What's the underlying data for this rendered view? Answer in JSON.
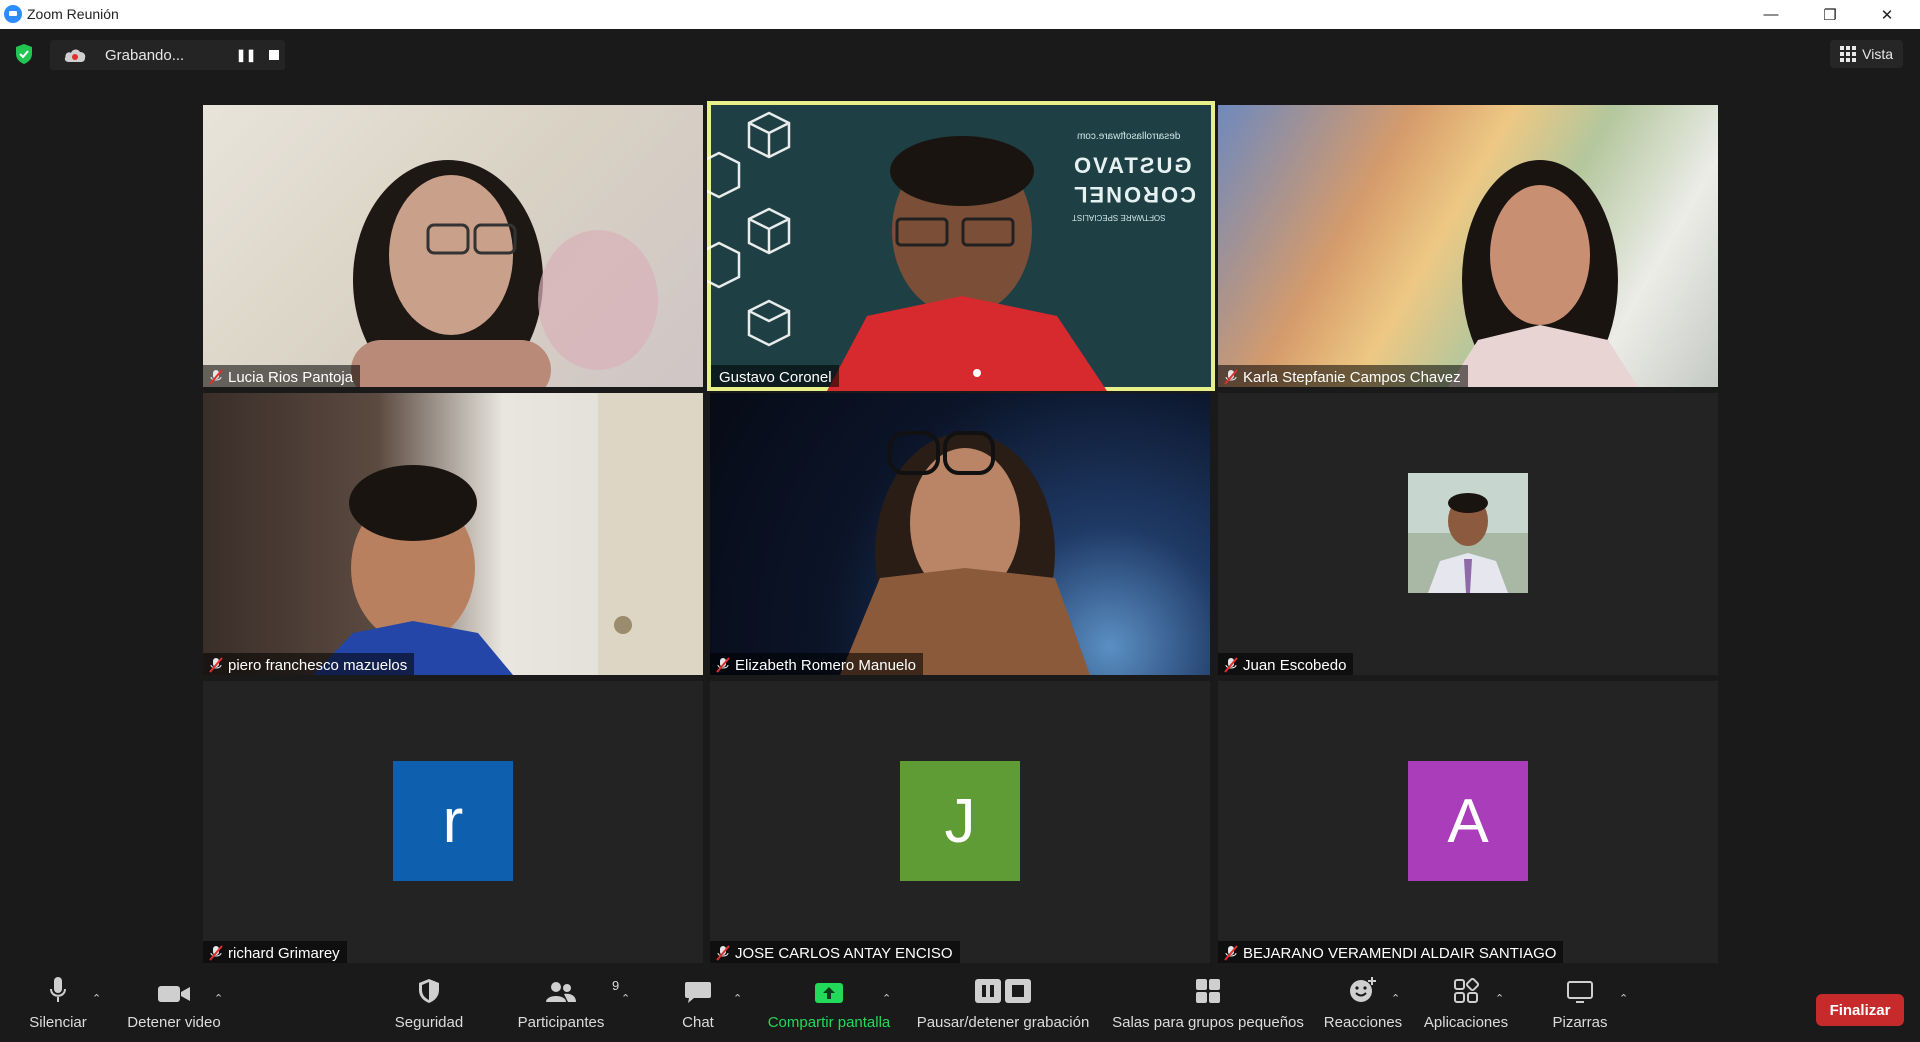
{
  "window": {
    "title": "Zoom Reunión",
    "minimize": "—",
    "restore": "❐",
    "close": "✕"
  },
  "recording": {
    "label": "Grabando...",
    "pause": "❚❚"
  },
  "view_button": {
    "label": "Vista"
  },
  "participants": [
    {
      "name": "Lucia Rios Pantoja",
      "muted": true,
      "video": true
    },
    {
      "name": "Gustavo Coronel",
      "muted": false,
      "video": true,
      "speaking": true
    },
    {
      "name": "Karla Stepfanie Campos Chavez",
      "muted": true,
      "video": true
    },
    {
      "name": "piero franchesco mazuelos",
      "muted": true,
      "video": true
    },
    {
      "name": "Elizabeth Romero Manuelo",
      "muted": true,
      "video": true
    },
    {
      "name": "Juan Escobedo",
      "muted": true,
      "video": false
    },
    {
      "name": "richard Grimarey",
      "muted": true,
      "video": false,
      "initial": "r",
      "color": "#0e5fad"
    },
    {
      "name": "JOSE CARLOS ANTAY ENCISO",
      "muted": true,
      "video": false,
      "initial": "J",
      "color": "#5f9c35"
    },
    {
      "name": "BEJARANO VERAMENDI ALDAIR SANTIAGO",
      "muted": true,
      "video": false,
      "initial": "A",
      "color": "#a93dba"
    }
  ],
  "background_overlay": {
    "site": "desarrollasoftware.com",
    "line1": "GUSTAVO",
    "line2": "CORONEL",
    "line3": "SOFTWARE SPECIALIST"
  },
  "toolbar": {
    "mute_label": "Silenciar",
    "video_label": "Detener video",
    "security_label": "Seguridad",
    "participants_label": "Participantes",
    "participants_count": "9",
    "chat_label": "Chat",
    "share_label": "Compartir pantalla",
    "record_label": "Pausar/detener grabación",
    "breakout_label": "Salas para grupos pequeños",
    "reactions_label": "Reacciones",
    "apps_label": "Aplicaciones",
    "whiteboards_label": "Pizarras",
    "end_label": "Finalizar",
    "caret": "⌃"
  },
  "colors": {
    "speaking_border": "#e8f08a",
    "share_green": "#23d959",
    "end_red": "#c72a2a",
    "accent_blue": "#2d8cff"
  }
}
